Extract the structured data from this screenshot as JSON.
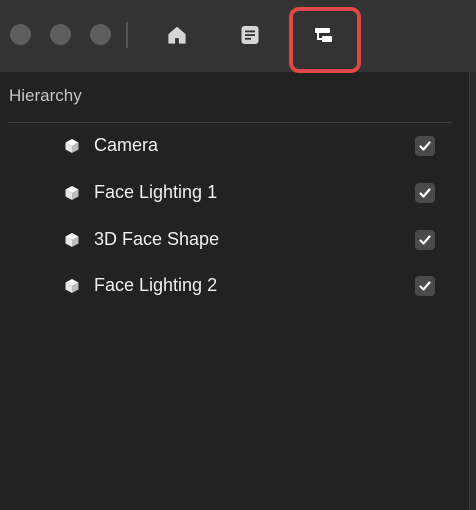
{
  "panel": {
    "title": "Hierarchy"
  },
  "toolbar": {
    "icons": [
      "home-icon",
      "document-icon",
      "hierarchy-icon"
    ],
    "selected": "hierarchy-icon",
    "highlight_color": "#e04848"
  },
  "hierarchy": {
    "items": [
      {
        "label": "Camera",
        "icon": "cube-icon",
        "checked": true
      },
      {
        "label": "Face Lighting 1",
        "icon": "cube-icon",
        "checked": true
      },
      {
        "label": "3D Face Shape",
        "icon": "cube-icon",
        "checked": true
      },
      {
        "label": "Face Lighting 2",
        "icon": "cube-icon",
        "checked": true
      }
    ]
  }
}
